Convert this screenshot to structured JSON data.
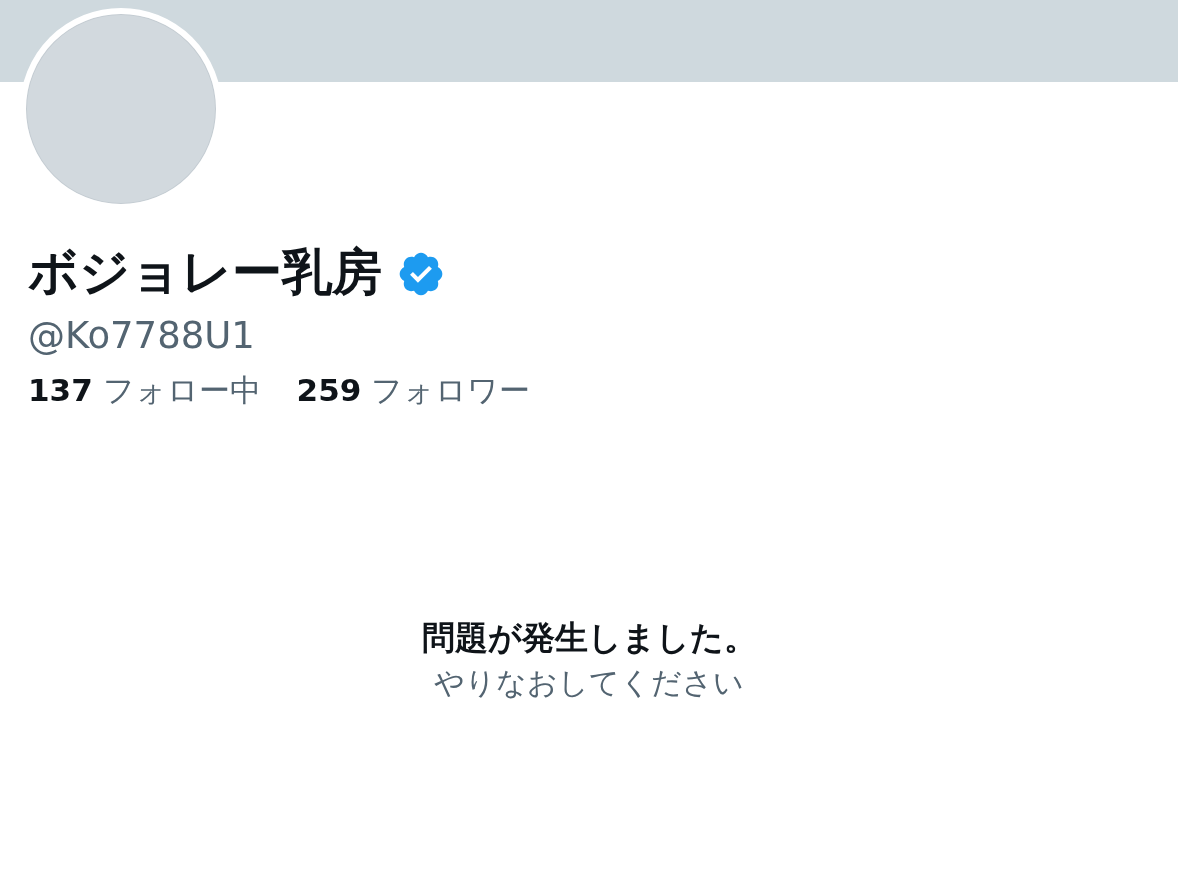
{
  "profile": {
    "display_name": "ボジョレー乳房",
    "verified": true,
    "handle": "@Ko7788U1",
    "stats": [
      {
        "text": "**137** フォロー中"
      },
      {
        "text": "**259** フォロワー"
      }
    ]
  },
  "error": {
    "title": "問題が発生しました。",
    "retry": "やりなおしてください"
  }
}
